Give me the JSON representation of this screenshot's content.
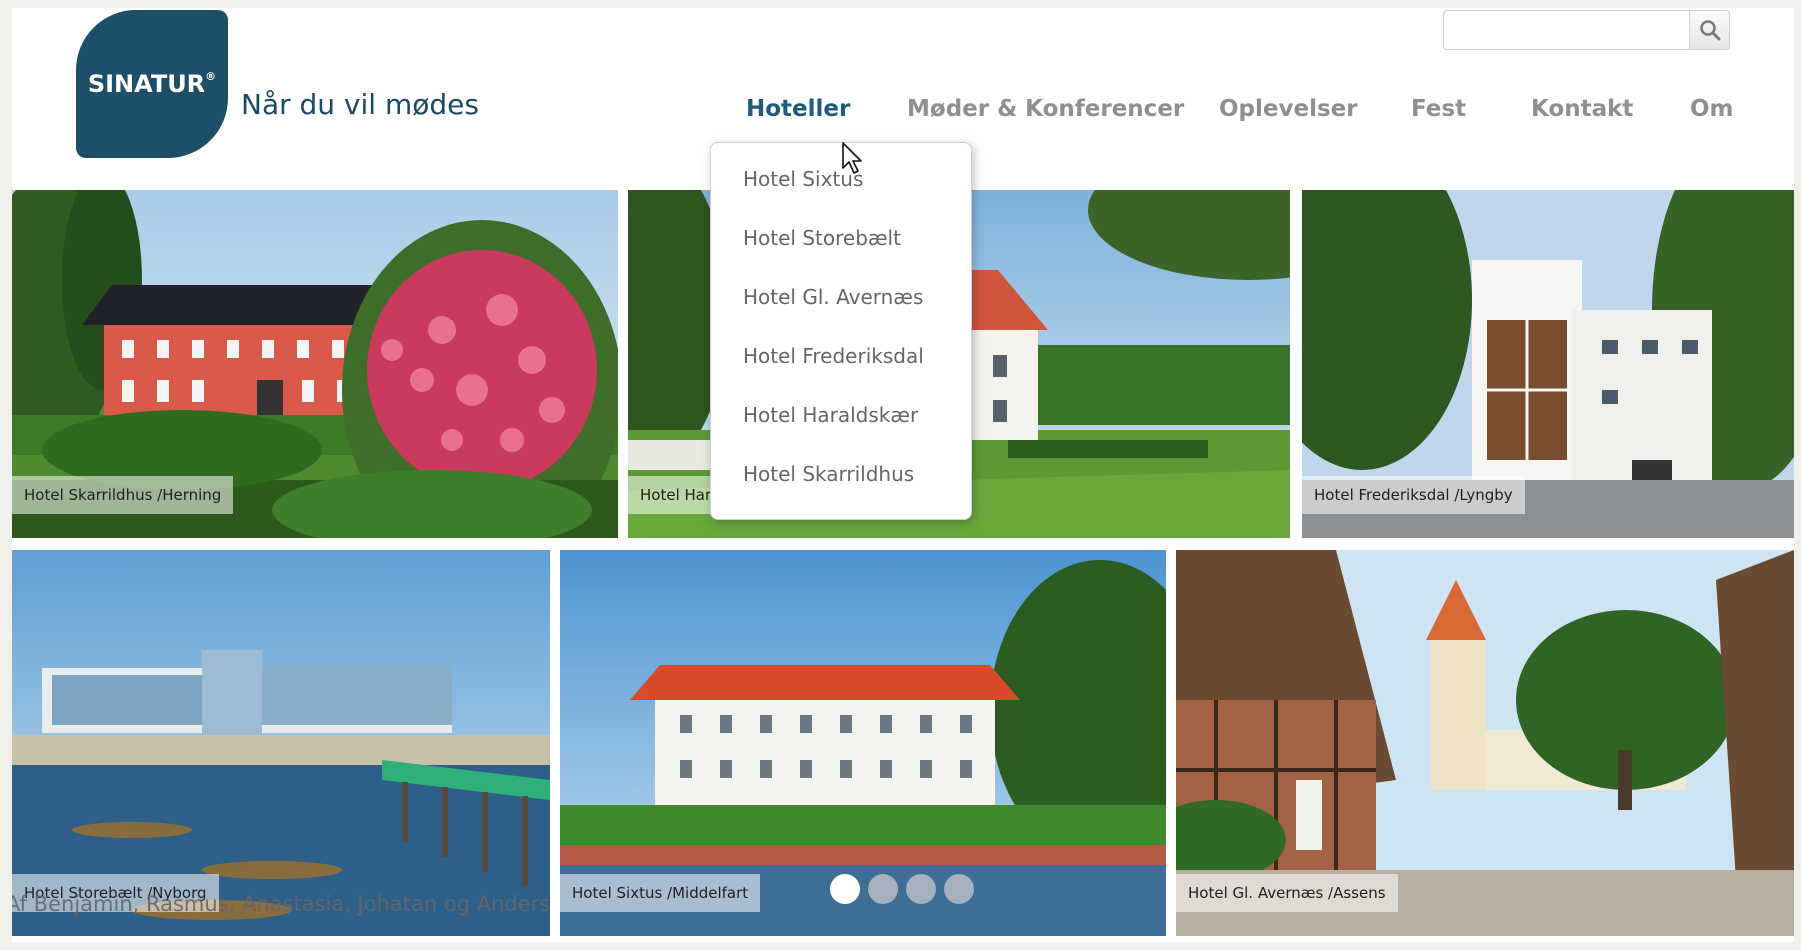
{
  "brand": {
    "logo_text": "SINATUR",
    "logo_mark": "®",
    "tagline": "Når du vil mødes",
    "color": "#1d5068"
  },
  "search": {
    "value": "",
    "placeholder": "",
    "icon": "search-icon"
  },
  "nav": [
    {
      "label": "Hoteller",
      "active": true
    },
    {
      "label": "Møder & Konferencer",
      "active": false
    },
    {
      "label": "Oplevelser",
      "active": false
    },
    {
      "label": "Fest",
      "active": false
    },
    {
      "label": "Kontakt",
      "active": false
    },
    {
      "label": "Om",
      "active": false
    }
  ],
  "dropdown": {
    "items": [
      "Hotel Sixtus",
      "Hotel Storebælt",
      "Hotel Gl. Avernæs",
      "Hotel Frederiksdal",
      "Hotel Haraldskær",
      "Hotel Skarrildhus"
    ]
  },
  "tiles": [
    {
      "caption": "Hotel Skarrildhus /Herning"
    },
    {
      "caption": "Hotel Haraldskær /Vejle"
    },
    {
      "caption": "Hotel Frederiksdal /Lyngby"
    },
    {
      "caption": "Hotel Storebælt /Nyborg"
    },
    {
      "caption": "Hotel Sixtus /Middelfart"
    },
    {
      "caption": "Hotel Gl. Avernæs /Assens"
    }
  ],
  "slider": {
    "dot_count": 4,
    "active_index": 0
  },
  "credit": "Af Benjamin, Rasmus, Anastasia, Johatan og Anders",
  "colors": {
    "nav_active": "#1e5a7e",
    "nav_inactive": "#8f8f8f",
    "accent": "#1d5068"
  }
}
